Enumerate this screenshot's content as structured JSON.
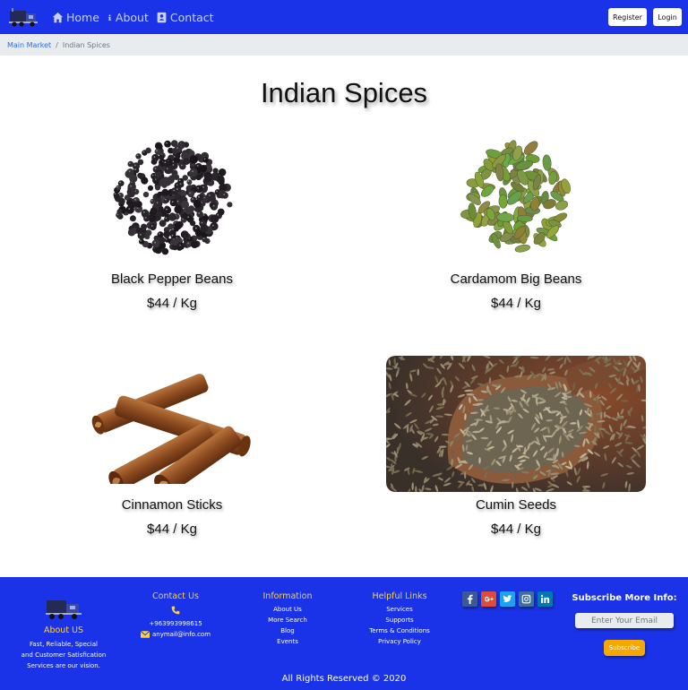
{
  "nav": {
    "logo_icon": "truck-logo",
    "links": [
      {
        "label": "Home",
        "icon": "home-icon"
      },
      {
        "label": "About",
        "icon": "info-icon"
      },
      {
        "label": "Contact",
        "icon": "address-book-icon"
      }
    ],
    "register_label": "Register",
    "login_label": "Login"
  },
  "breadcrumb": {
    "parent": "Main Market",
    "current": "Indian Spices"
  },
  "page_title": "Indian Spices",
  "products": [
    {
      "name": "Black Pepper Beans",
      "price": "$44 / Kg",
      "image": "black-pepper-image"
    },
    {
      "name": "Cardamom Big Beans",
      "price": "$44 / Kg",
      "image": "cardamom-image"
    },
    {
      "name": "Cinnamon Sticks",
      "price": "$44 / Kg",
      "image": "cinnamon-image"
    },
    {
      "name": "Cumin Seeds",
      "price": "$44 / Kg",
      "image": "cumin-image"
    }
  ],
  "footer": {
    "about": {
      "heading": "About US",
      "text_lines": [
        "Fast, Reliable, Special",
        "and Customer Satisfication",
        "Services are our vision."
      ]
    },
    "contact": {
      "heading": "Contact Us",
      "phone": "+963993998615",
      "email": "anymail@info.com"
    },
    "information": {
      "heading": "Information",
      "links": [
        "About Us",
        "More Search",
        "Blog",
        "Events"
      ]
    },
    "helpful": {
      "heading": "Helpful Links",
      "links": [
        "Services",
        "Supports",
        "Terms & Conditions",
        "Privacy Policy"
      ]
    },
    "social": [
      {
        "icon": "facebook-icon",
        "color": "#3b5998"
      },
      {
        "icon": "google-plus-icon",
        "color": "#dd4b39"
      },
      {
        "icon": "twitter-icon",
        "color": "#1da1f2"
      },
      {
        "icon": "instagram-icon",
        "color": "#3f729b"
      },
      {
        "icon": "linkedin-icon",
        "color": "#0077b5"
      }
    ],
    "subscribe": {
      "title": "Subscribe More Info:",
      "placeholder": "Enter Your Email",
      "button_label": "Subscribe"
    },
    "copyright": "All Rights Reserved © 2020"
  },
  "colors": {
    "brand_blue": "#1a33e8",
    "footer_heading": "#ffd43b",
    "subscribe_button": "#f7a800"
  }
}
